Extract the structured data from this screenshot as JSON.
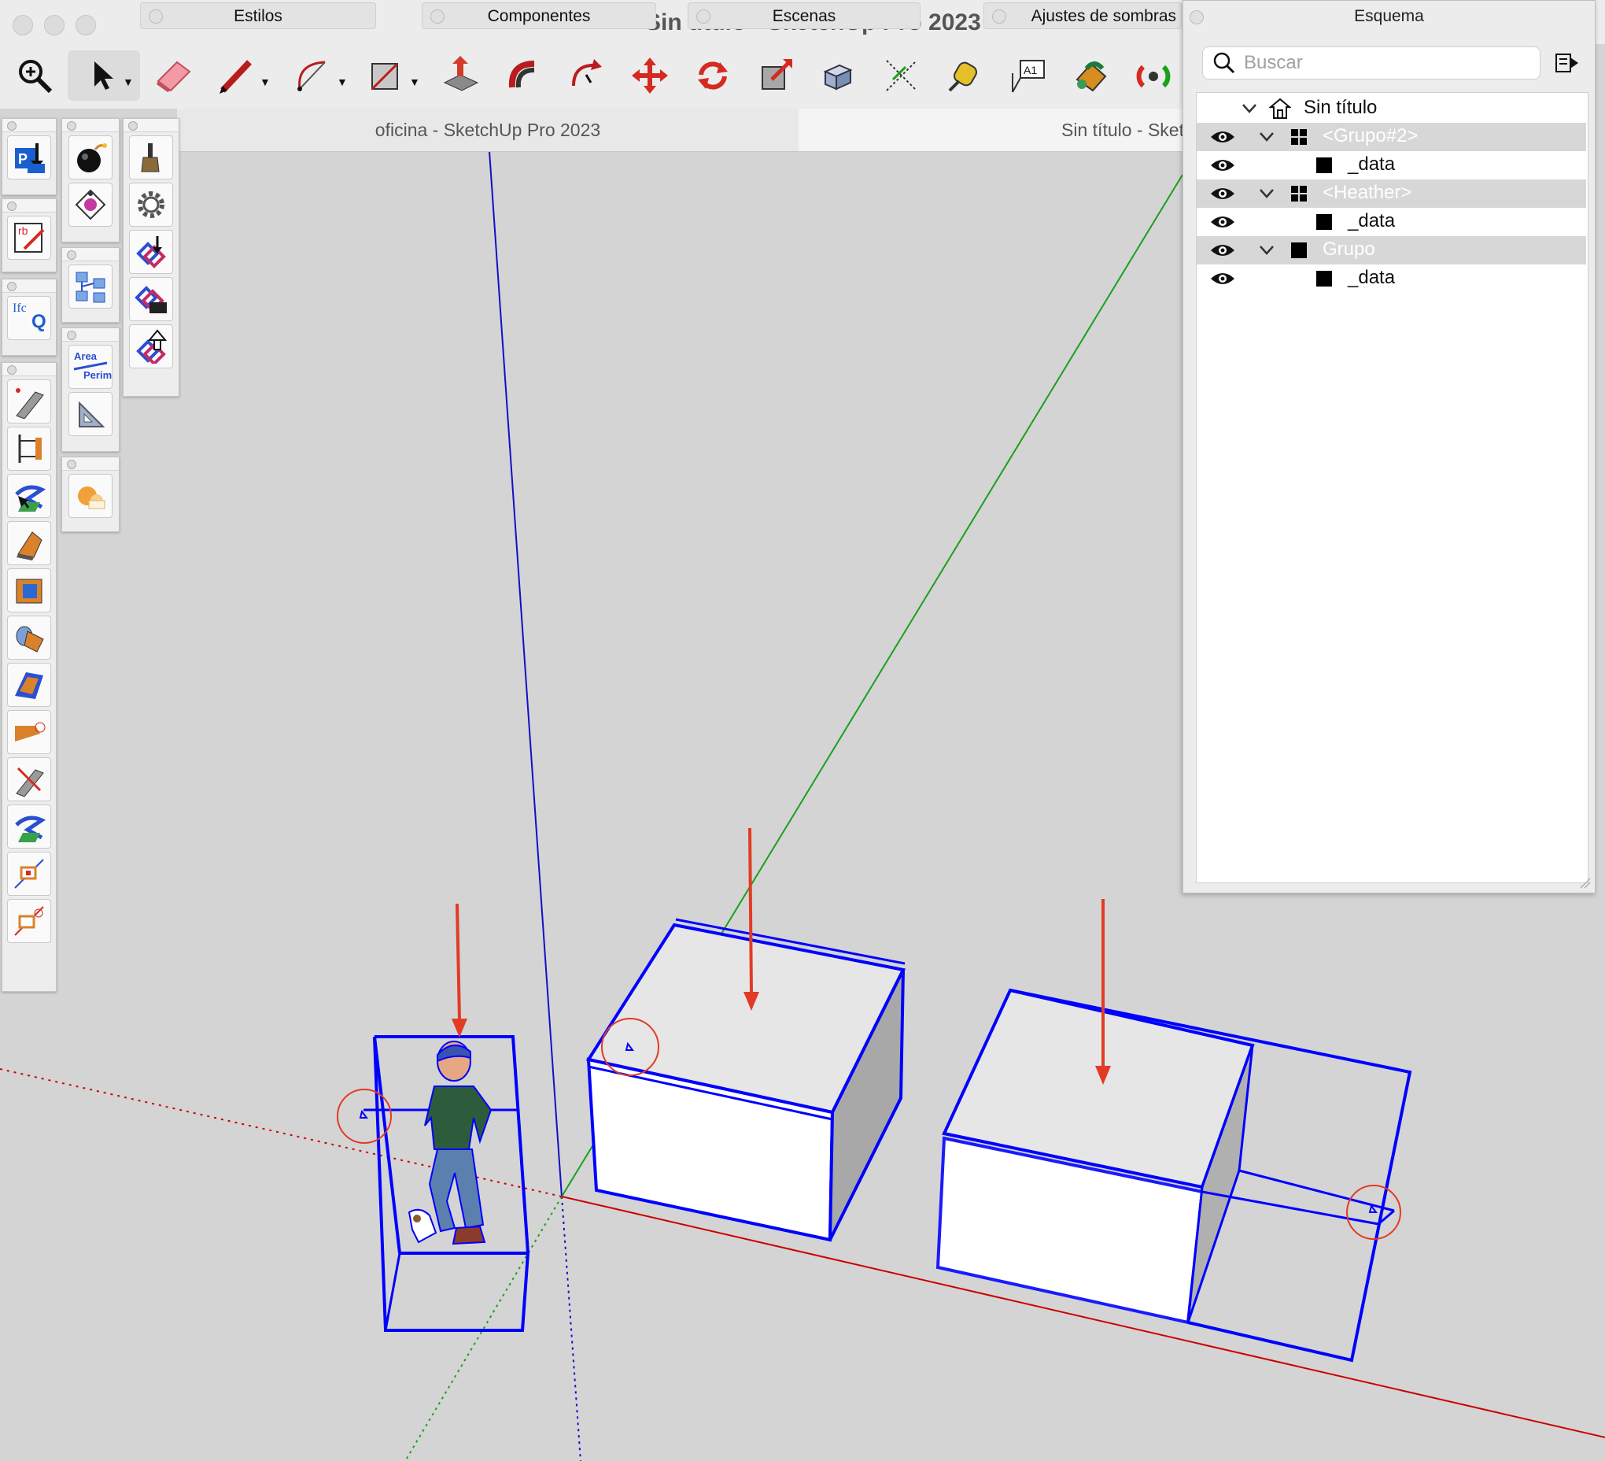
{
  "window": {
    "title": "Sin título - SketchUp Pro 2023"
  },
  "trays": {
    "estilos": "Estilos",
    "componentes": "Componentes",
    "escenas": "Escenas",
    "sombras": "Ajustes de sombras"
  },
  "toolbar": {
    "tools": [
      "zoom-icon",
      "select-arrow-icon",
      "eraser-icon",
      "pencil-icon",
      "arc-icon",
      "rectangle-icon",
      "push-pull-icon",
      "offset-icon",
      "follow-me-icon",
      "move-icon",
      "rotate-icon",
      "scale-icon",
      "intersect-icon",
      "protractor-icon",
      "tape-measure-icon",
      "text-label-icon",
      "paint-bucket-icon",
      "orbit-icon"
    ]
  },
  "doc_tabs": {
    "tab1": "oficina - SketchUp Pro 2023",
    "tab2": "Sin título - Sket"
  },
  "outliner": {
    "title": "Esquema",
    "search_placeholder": "Buscar",
    "root": "Sin título",
    "rows": [
      {
        "label": "<Grupo#2>",
        "kind": "component",
        "selected": true
      },
      {
        "label": "_data",
        "kind": "group",
        "selected": false
      },
      {
        "label": "<Heather>",
        "kind": "component",
        "selected": true
      },
      {
        "label": "_data",
        "kind": "group",
        "selected": false
      },
      {
        "label": "Grupo",
        "kind": "group",
        "selected": true
      },
      {
        "label": "_data",
        "kind": "group",
        "selected": false
      }
    ]
  },
  "palettes": {
    "area_label_line1": "Area",
    "area_label_line2": "Perim",
    "ifc_label": "Ifc",
    "ifc_q": "Q"
  },
  "colors": {
    "selection": "#0000ff",
    "annotation": "#e23b25",
    "axis_red": "#cc0000",
    "axis_green": "#1aa01a",
    "axis_blue": "#0000cc",
    "viewport_bg": "#d4d4d4"
  }
}
